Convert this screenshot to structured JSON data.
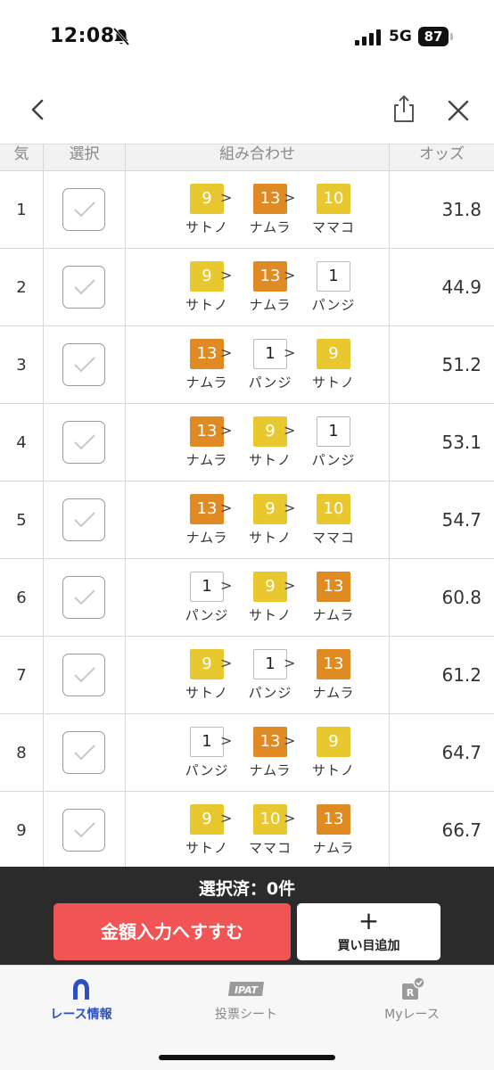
{
  "status": {
    "time": "12:08",
    "network": "5G",
    "battery": "87"
  },
  "header": {
    "col_rank": "気",
    "col_select": "選択",
    "col_combo": "組み合わせ",
    "col_odds": "オッズ"
  },
  "rows": [
    {
      "rank": "1",
      "odds": "31.8",
      "horses": [
        {
          "num": "9",
          "name": "サトノ",
          "color": "yellow"
        },
        {
          "num": "13",
          "name": "ナムラ",
          "color": "orange"
        },
        {
          "num": "10",
          "name": "ママコ",
          "color": "yellow"
        }
      ]
    },
    {
      "rank": "2",
      "odds": "44.9",
      "horses": [
        {
          "num": "9",
          "name": "サトノ",
          "color": "yellow"
        },
        {
          "num": "13",
          "name": "ナムラ",
          "color": "orange"
        },
        {
          "num": "1",
          "name": "パンジ",
          "color": "white"
        }
      ]
    },
    {
      "rank": "3",
      "odds": "51.2",
      "horses": [
        {
          "num": "13",
          "name": "ナムラ",
          "color": "orange"
        },
        {
          "num": "1",
          "name": "パンジ",
          "color": "white"
        },
        {
          "num": "9",
          "name": "サトノ",
          "color": "yellow"
        }
      ]
    },
    {
      "rank": "4",
      "odds": "53.1",
      "horses": [
        {
          "num": "13",
          "name": "ナムラ",
          "color": "orange"
        },
        {
          "num": "9",
          "name": "サトノ",
          "color": "yellow"
        },
        {
          "num": "1",
          "name": "パンジ",
          "color": "white"
        }
      ]
    },
    {
      "rank": "5",
      "odds": "54.7",
      "horses": [
        {
          "num": "13",
          "name": "ナムラ",
          "color": "orange"
        },
        {
          "num": "9",
          "name": "サトノ",
          "color": "yellow"
        },
        {
          "num": "10",
          "name": "ママコ",
          "color": "yellow"
        }
      ]
    },
    {
      "rank": "6",
      "odds": "60.8",
      "horses": [
        {
          "num": "1",
          "name": "パンジ",
          "color": "white"
        },
        {
          "num": "9",
          "name": "サトノ",
          "color": "yellow"
        },
        {
          "num": "13",
          "name": "ナムラ",
          "color": "orange"
        }
      ]
    },
    {
      "rank": "7",
      "odds": "61.2",
      "horses": [
        {
          "num": "9",
          "name": "サトノ",
          "color": "yellow"
        },
        {
          "num": "1",
          "name": "パンジ",
          "color": "white"
        },
        {
          "num": "13",
          "name": "ナムラ",
          "color": "orange"
        }
      ]
    },
    {
      "rank": "8",
      "odds": "64.7",
      "horses": [
        {
          "num": "1",
          "name": "パンジ",
          "color": "white"
        },
        {
          "num": "13",
          "name": "ナムラ",
          "color": "orange"
        },
        {
          "num": "9",
          "name": "サトノ",
          "color": "yellow"
        }
      ]
    },
    {
      "rank": "9",
      "odds": "66.7",
      "horses": [
        {
          "num": "9",
          "name": "サトノ",
          "color": "yellow"
        },
        {
          "num": "10",
          "name": "ママコ",
          "color": "yellow"
        },
        {
          "num": "13",
          "name": "ナムラ",
          "color": "orange"
        }
      ]
    }
  ],
  "arrow_symbol": ">",
  "action": {
    "selected_text": "選択済：0件",
    "primary_label": "金額入力へすすむ",
    "secondary_plus": "+",
    "secondary_label": "買い目追加"
  },
  "tabs": [
    {
      "label": "レース情報",
      "icon": "horseshoe-icon",
      "active": true
    },
    {
      "label": "投票シート",
      "icon": "ipat-icon",
      "badge_text": "IPAT",
      "active": false
    },
    {
      "label": "Myレース",
      "icon": "my-race-icon",
      "badge_text": "R",
      "active": false
    }
  ],
  "colors": {
    "yellow": "#e8c82e",
    "orange": "#df8a22",
    "primary": "#f05454",
    "active_tab": "#2d4fc0",
    "action_bg": "#2b2b2b"
  }
}
